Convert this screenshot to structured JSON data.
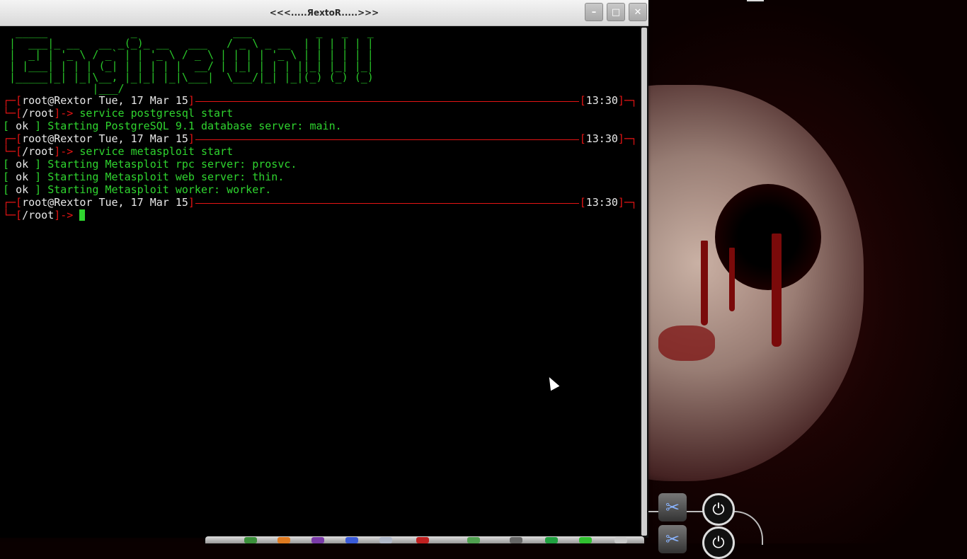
{
  "window": {
    "title": "<<<.....ЯextoR.....>>>",
    "buttons": {
      "minimize": "–",
      "maximize": "□",
      "close": "✕"
    }
  },
  "terminal": {
    "banner": "  _____             _               ___          _   _   _ \n |  ___|_ __   __ _(_)_ __   ___   / _ \\ _ __  | | | | | |\n |  _| | '_ \\ / _` | | '_ \\ / _ \\ | | | | '_ \\ | | | | | |\n | |___| | | | (_| | | | | |  __/ | |_| | | | ||_| |_| |_|\n |_____|_| |_|\\__, |_|_| |_|\\___|  \\___/|_| |_|(_) (_) (_)\n              |___/",
    "sessions": [
      {
        "header_user": "root@Rextor",
        "header_date": "Tue, 17 Mar 15",
        "time": "13:30",
        "cwd": "/root",
        "command": "service postgresql start",
        "outputs": [
          {
            "status": "ok",
            "message": "Starting PostgreSQL 9.1 database server: main."
          }
        ]
      },
      {
        "header_user": "root@Rextor",
        "header_date": "Tue, 17 Mar 15",
        "time": "13:30",
        "cwd": "/root",
        "command": "service metasploit start",
        "outputs": [
          {
            "status": "ok",
            "message": "Starting Metasploit rpc server: prosvc."
          },
          {
            "status": "ok",
            "message": "Starting Metasploit web server: thin."
          },
          {
            "status": "ok",
            "message": "Starting Metasploit worker: worker."
          }
        ]
      },
      {
        "header_user": "root@Rextor",
        "header_date": "Tue, 17 Mar 15",
        "time": "13:30",
        "cwd": "/root",
        "command": "",
        "outputs": []
      }
    ],
    "prompt_arrow": "->",
    "accent_red": "#e41414",
    "accent_green": "#2fd52f"
  },
  "desktop": {
    "wallpaper": "blood-face-wallpaper",
    "gadgets": [
      "scissors-icon",
      "power-icon"
    ]
  }
}
